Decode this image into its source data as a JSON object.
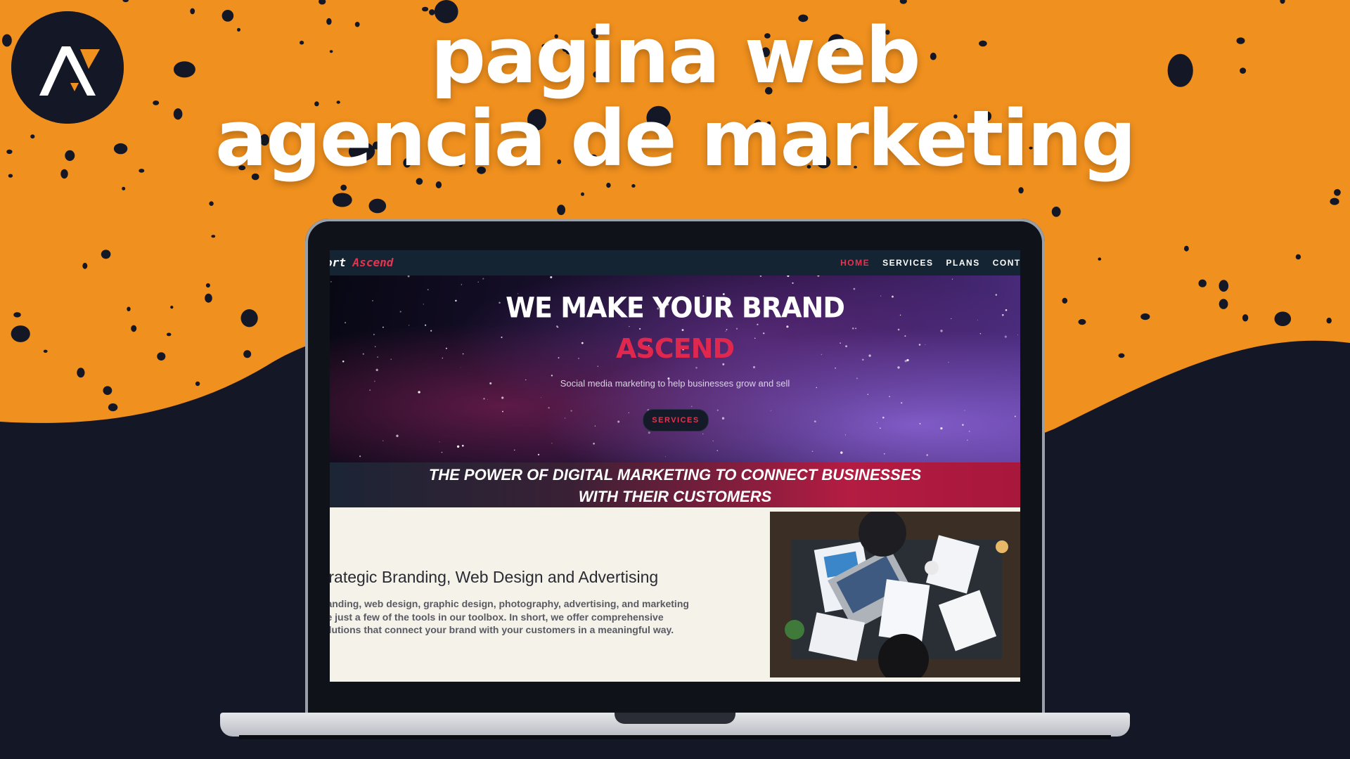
{
  "thumbnail": {
    "headline_line1": "pagina web",
    "headline_line2": "agencia de marketing",
    "colors": {
      "orange": "#f0901e",
      "navy": "#141826",
      "accent_red": "#e63350"
    },
    "logo_icon": "ascend-chevron-logo"
  },
  "site": {
    "brand_prefix": "ort",
    "brand_accent": "Ascend",
    "nav": {
      "items": [
        {
          "label": "HOME",
          "active": true
        },
        {
          "label": "SERVICES",
          "active": false
        },
        {
          "label": "PLANS",
          "active": false
        },
        {
          "label": "CONTA",
          "active": false
        }
      ]
    },
    "hero": {
      "title": "WE MAKE YOUR BRAND",
      "subtitle": "ASCEND",
      "tagline": "Social media marketing to help businesses grow and sell",
      "button_label": "SERVICES"
    },
    "banner": {
      "line1": "THE POWER OF DIGITAL MARKETING TO CONNECT BUSINESSES",
      "line2": "WITH THEIR CUSTOMERS"
    },
    "content": {
      "title": "trategic Branding, Web Design and Advertising",
      "text_line1": "randing, web design, graphic design, photography, advertising, and marketing",
      "text_line2": "re just a few of the tools in our toolbox. In short, we offer comprehensive",
      "text_line3": "olutions that connect your brand with your customers in a meaningful way.",
      "image_icon": "office-desk-photo"
    }
  }
}
